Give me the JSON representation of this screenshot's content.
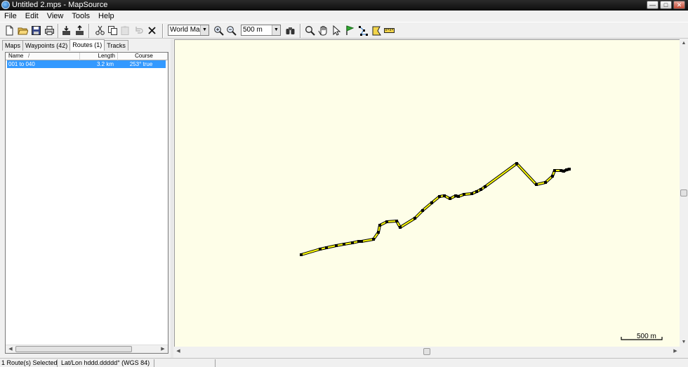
{
  "window": {
    "title": "Untitled 2.mps - MapSource",
    "controls": {
      "minimize": "—",
      "maximize": "□",
      "close": "✕"
    }
  },
  "menu": [
    "File",
    "Edit",
    "View",
    "Tools",
    "Help"
  ],
  "toolbar": {
    "icons": [
      "new-file-icon",
      "open-folder-icon",
      "save-icon",
      "print-icon",
      "receive-from-device-icon",
      "send-to-device-icon",
      "cut-icon",
      "copy-icon",
      "paste-icon",
      "undo-icon",
      "delete-icon",
      "zoom-in-icon",
      "zoom-out-icon",
      "find-binoculars-icon",
      "zoom-tool-icon",
      "pan-hand-icon",
      "select-arrow-icon",
      "waypoint-flag-icon",
      "route-tool-icon",
      "map-tool-icon",
      "measure-ruler-icon"
    ],
    "map_product": "World Map",
    "zoom_scale": "500 m"
  },
  "tabs": [
    {
      "label": "Maps",
      "active": false
    },
    {
      "label": "Waypoints (42)",
      "active": false
    },
    {
      "label": "Routes (1)",
      "active": true
    },
    {
      "label": "Tracks",
      "active": false
    }
  ],
  "routes_list": {
    "columns": {
      "name": "Name",
      "length": "Length",
      "course": "Course"
    },
    "sort_indicator": "/",
    "rows": [
      {
        "name": "001 to 040",
        "length": "3.2 km",
        "course": "253° true",
        "selected": true
      }
    ]
  },
  "map": {
    "background_color": "#fefee8",
    "route_color": "#ffff00",
    "waypoint_color": "#000000",
    "scale_label": "500 m"
  },
  "status": {
    "selection": "1 Route(s) Selected",
    "position_format": "Lat/Lon hddd.ddddd° (WGS 84)"
  }
}
